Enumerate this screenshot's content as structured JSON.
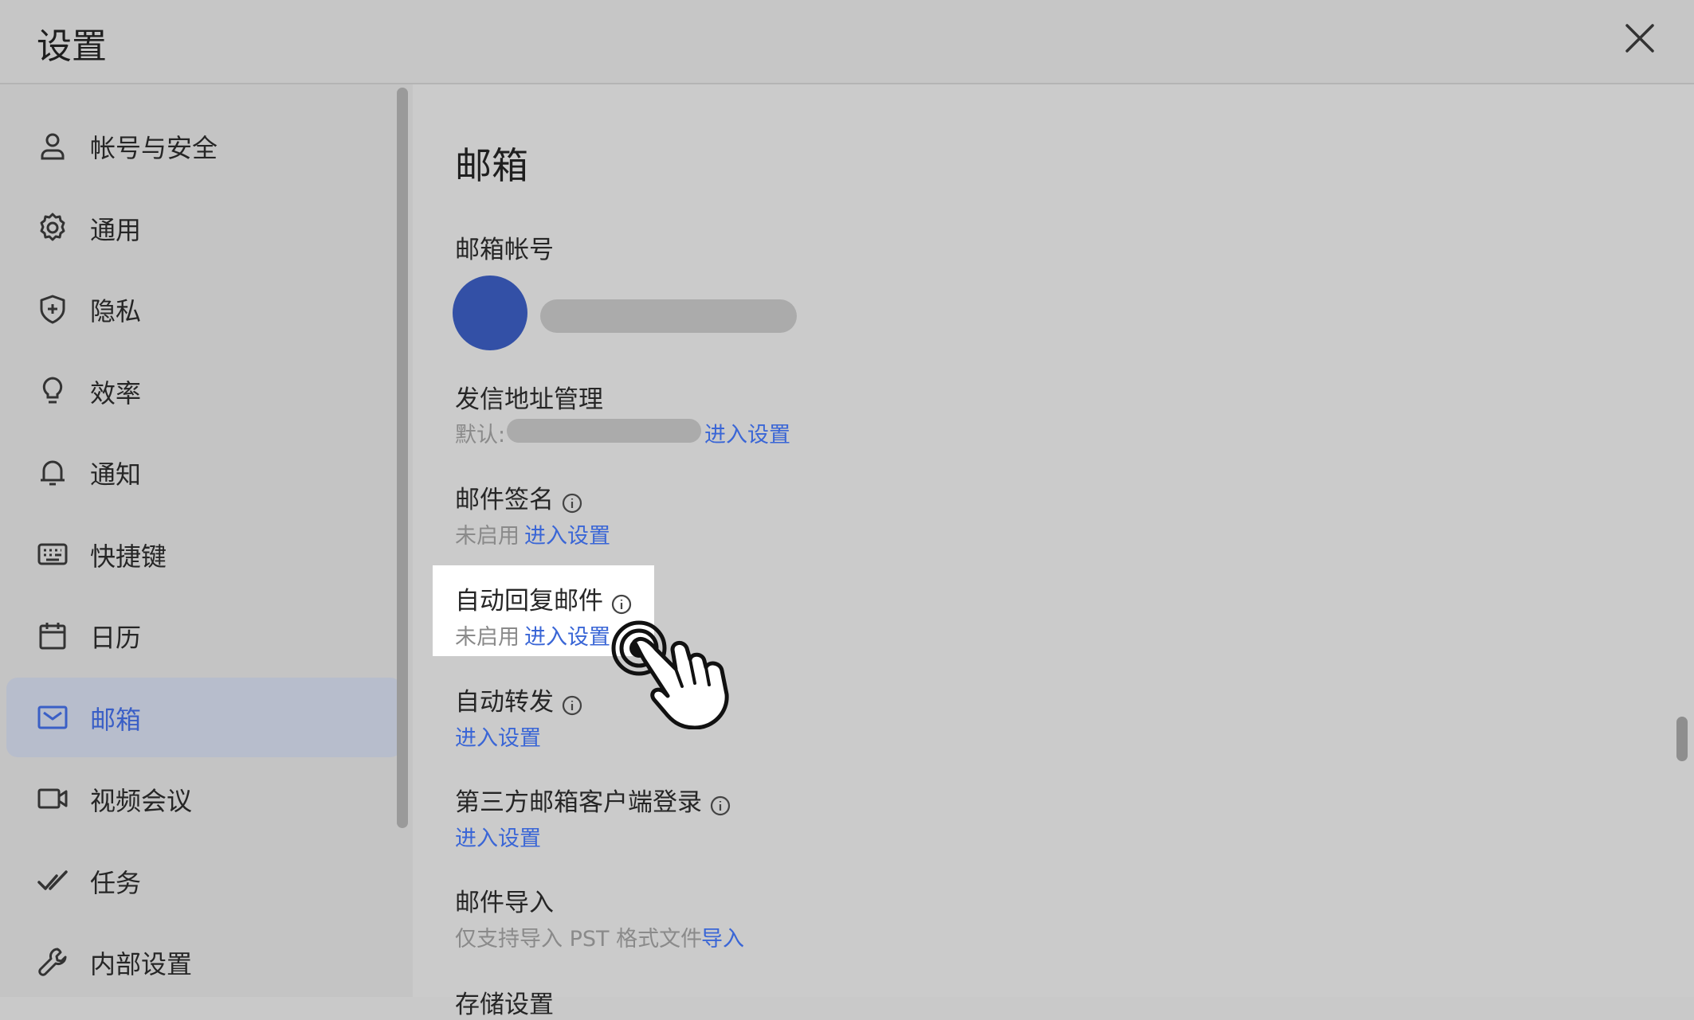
{
  "window": {
    "title": "设置",
    "close_icon": "close-icon"
  },
  "sidebar": {
    "items": [
      {
        "label": "帐号与安全",
        "icon": "person-icon",
        "active": false
      },
      {
        "label": "通用",
        "icon": "gear-icon",
        "active": false
      },
      {
        "label": "隐私",
        "icon": "shield-icon",
        "active": false
      },
      {
        "label": "效率",
        "icon": "lightbulb-icon",
        "active": false
      },
      {
        "label": "通知",
        "icon": "bell-icon",
        "active": false
      },
      {
        "label": "快捷键",
        "icon": "keyboard-icon",
        "active": false
      },
      {
        "label": "日历",
        "icon": "calendar-icon",
        "active": false
      },
      {
        "label": "邮箱",
        "icon": "mail-icon",
        "active": true
      },
      {
        "label": "视频会议",
        "icon": "video-icon",
        "active": false
      },
      {
        "label": "任务",
        "icon": "checkmark-icon",
        "active": false
      },
      {
        "label": "内部设置",
        "icon": "wrench-icon",
        "active": false
      }
    ]
  },
  "main": {
    "title": "邮箱",
    "account": {
      "label": "邮箱帐号"
    },
    "sender": {
      "label": "发信地址管理",
      "default_prefix": "默认:",
      "link": "进入设置"
    },
    "signature": {
      "label": "邮件签名",
      "status": "未启用",
      "link": "进入设置"
    },
    "auto_reply": {
      "label": "自动回复邮件",
      "status": "未启用",
      "link": "进入设置"
    },
    "auto_forward": {
      "label": "自动转发",
      "link": "进入设置"
    },
    "third_party": {
      "label": "第三方邮箱客户端登录",
      "link": "进入设置"
    },
    "import": {
      "label": "邮件导入",
      "desc": "仅支持导入 PST 格式文件",
      "link": "导入"
    },
    "next_section": {
      "label": "存储设置"
    }
  },
  "colors": {
    "accent": "#3a66d6",
    "avatar": "#3350a6",
    "active_bg": "#b7bdcc"
  }
}
